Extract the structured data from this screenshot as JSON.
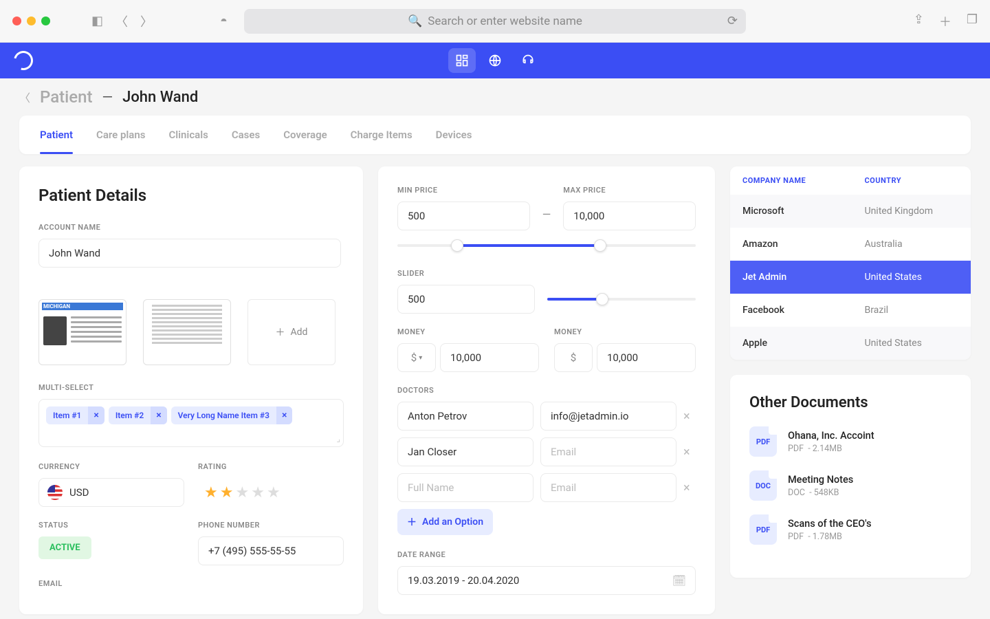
{
  "chrome": {
    "url_placeholder": "Search or enter website name"
  },
  "breadcrumb": {
    "section": "Patient",
    "name": "John Wand"
  },
  "tabs": [
    "Patient",
    "Care plans",
    "Clinicals",
    "Cases",
    "Coverage",
    "Charge Items",
    "Devices"
  ],
  "col1": {
    "title": "Patient Details",
    "account_label": "ACCOUNT NAME",
    "account_value": "John Wand",
    "add_label": "Add",
    "multi_label": "MULTI-SELECT",
    "chips": [
      "Item #1",
      "Item #2",
      "Very Long Name Item #3"
    ],
    "currency_label": "CURRENCY",
    "currency_value": "USD",
    "rating_label": "RATING",
    "rating_value": 2,
    "status_label": "STATUS",
    "status_value": "ACTIVE",
    "phone_label": "PHONE NUMBER",
    "phone_value": "+7 (495) 555-55-55",
    "email_label": "EMAIL"
  },
  "col2": {
    "min_price_label": "MIN PRICE",
    "min_price": "500",
    "max_price_label": "MAX PRICE",
    "max_price": "10,000",
    "slider_label": "SLIDER",
    "slider_value": "500",
    "money_label": "MONEY",
    "money_a": "10,000",
    "money_b": "10,000",
    "doctors_label": "DOCTORS",
    "doctors": [
      {
        "name": "Anton Petrov",
        "email": "info@jetadmin.io"
      },
      {
        "name": "Jan Closer",
        "email": ""
      },
      {
        "name": "",
        "email": ""
      }
    ],
    "name_ph": "Full Name",
    "email_ph": "Email",
    "add_option": "Add an Option",
    "date_label": "DATE RANGE",
    "date_value": "19.03.2019 - 20.04.2020"
  },
  "companies": {
    "h1": "COMPANY NAME",
    "h2": "COUNTRY",
    "rows": [
      {
        "c": "Microsoft",
        "n": "United Kingdom"
      },
      {
        "c": "Amazon",
        "n": "Australia"
      },
      {
        "c": "Jet Admin",
        "n": "United States",
        "sel": true
      },
      {
        "c": "Facebook",
        "n": "Brazil"
      },
      {
        "c": "Apple",
        "n": "United States"
      }
    ]
  },
  "docs": {
    "title": "Other Documents",
    "items": [
      {
        "badge": "PDF",
        "name": "Ohana, Inc. Accoint",
        "t": "PDF",
        "s": "2.14MB"
      },
      {
        "badge": "DOC",
        "name": "Meeting Notes",
        "t": "DOC",
        "s": "548KB"
      },
      {
        "badge": "PDF",
        "name": "Scans of the CEO's",
        "t": "PDF",
        "s": "1.78MB"
      }
    ]
  }
}
